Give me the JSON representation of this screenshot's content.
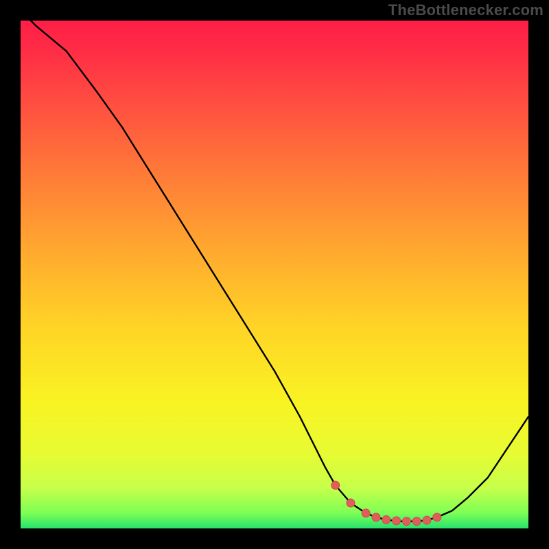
{
  "watermark": "TheBottlenecker.com",
  "colors": {
    "frame": "#000000",
    "watermark_text": "#4b4b4b",
    "curve": "#000000",
    "marker_fill": "#e15d5d",
    "marker_stroke": "#d04949",
    "gradient_stops": [
      {
        "offset": 0.0,
        "color": "#ff1f47"
      },
      {
        "offset": 0.05,
        "color": "#ff2a46"
      },
      {
        "offset": 0.15,
        "color": "#ff4a41"
      },
      {
        "offset": 0.3,
        "color": "#ff7a38"
      },
      {
        "offset": 0.45,
        "color": "#ffa82f"
      },
      {
        "offset": 0.6,
        "color": "#ffd326"
      },
      {
        "offset": 0.75,
        "color": "#f9f323"
      },
      {
        "offset": 0.85,
        "color": "#e8fb32"
      },
      {
        "offset": 0.92,
        "color": "#c7ff4a"
      },
      {
        "offset": 0.97,
        "color": "#7dff55"
      },
      {
        "offset": 1.0,
        "color": "#26e26e"
      }
    ]
  },
  "chart_data": {
    "type": "line",
    "title": "",
    "xlabel": "",
    "ylabel": "",
    "xlim": [
      0,
      100
    ],
    "ylim": [
      0,
      100
    ],
    "x": [
      0,
      3,
      6,
      9,
      12,
      15,
      20,
      25,
      30,
      35,
      40,
      45,
      50,
      55,
      58,
      60,
      62,
      65,
      68,
      70,
      72,
      75,
      78,
      80,
      82,
      85,
      88,
      92,
      96,
      100
    ],
    "values": [
      102,
      99,
      96.5,
      94,
      90,
      86,
      79,
      71,
      63,
      55,
      47,
      39,
      31,
      22,
      16,
      12,
      8.5,
      5,
      3,
      2.2,
      1.7,
      1.4,
      1.4,
      1.6,
      2.2,
      3.5,
      6,
      10,
      16,
      22
    ],
    "markers_x": [
      62,
      65,
      68,
      70,
      72,
      74,
      76,
      78,
      80,
      82
    ],
    "markers_y": [
      8.5,
      5,
      3,
      2.2,
      1.7,
      1.5,
      1.4,
      1.4,
      1.6,
      2.2
    ],
    "grid": false,
    "legend": false
  }
}
